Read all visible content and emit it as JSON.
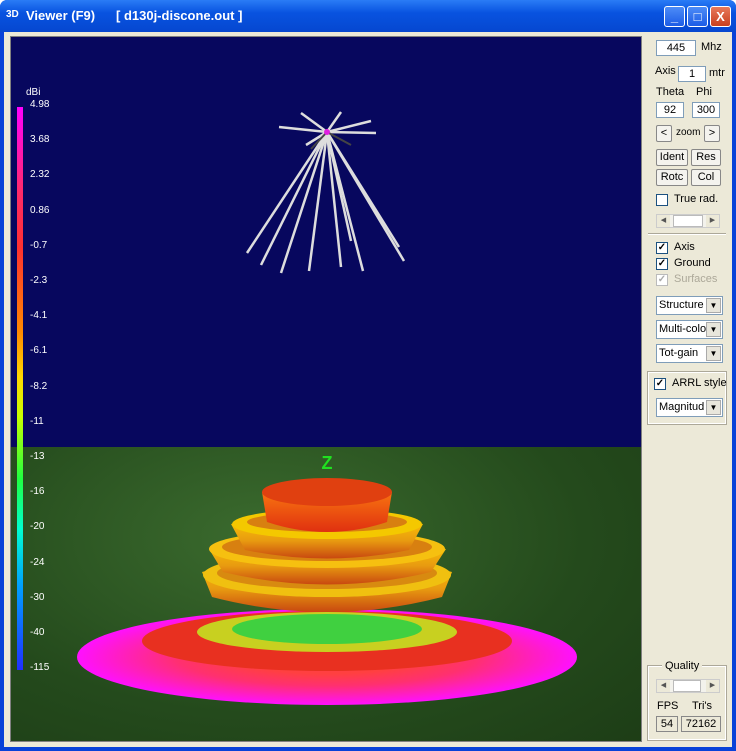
{
  "window": {
    "icon": "3D",
    "title": "Viewer (F9)",
    "file": "[  d130j-discone.out ]",
    "minimize": "_",
    "maximize": "□",
    "close": "X"
  },
  "legend": {
    "unit": "dBi",
    "labels": [
      "4.98",
      "3.68",
      "2.32",
      "0.86",
      "-0.7",
      "-2.3",
      "-4.1",
      "-6.1",
      "-8.2",
      "-11",
      "-13",
      "-16",
      "-20",
      "-24",
      "-30",
      "-40",
      "-115"
    ]
  },
  "scene": {
    "axis_label": "Z"
  },
  "panel": {
    "freq": "445",
    "freq_unit": "Mhz",
    "axis_label": "Axis",
    "axis": "1",
    "axis_unit": "mtr",
    "theta_label": "Theta",
    "phi_label": "Phi",
    "theta": "92",
    "phi": "300",
    "zoom_prev": "<",
    "zoom_label": "zoom",
    "zoom_next": ">",
    "ident": "Ident",
    "res": "Res",
    "rotc": "Rotc",
    "col": "Col",
    "true_rad": "True rad.",
    "axis_cb": "Axis",
    "ground_cb": "Ground",
    "surfaces_cb": "Surfaces",
    "display_select": "Structure",
    "color_select": "Multi-colo",
    "gain_select": "Tot-gain",
    "arrl": "ARRL style",
    "mag_select": "Magnitud",
    "quality": "Quality",
    "fps_label": "FPS",
    "tris_label": "Tri's",
    "fps": "54",
    "tris": "72162"
  }
}
